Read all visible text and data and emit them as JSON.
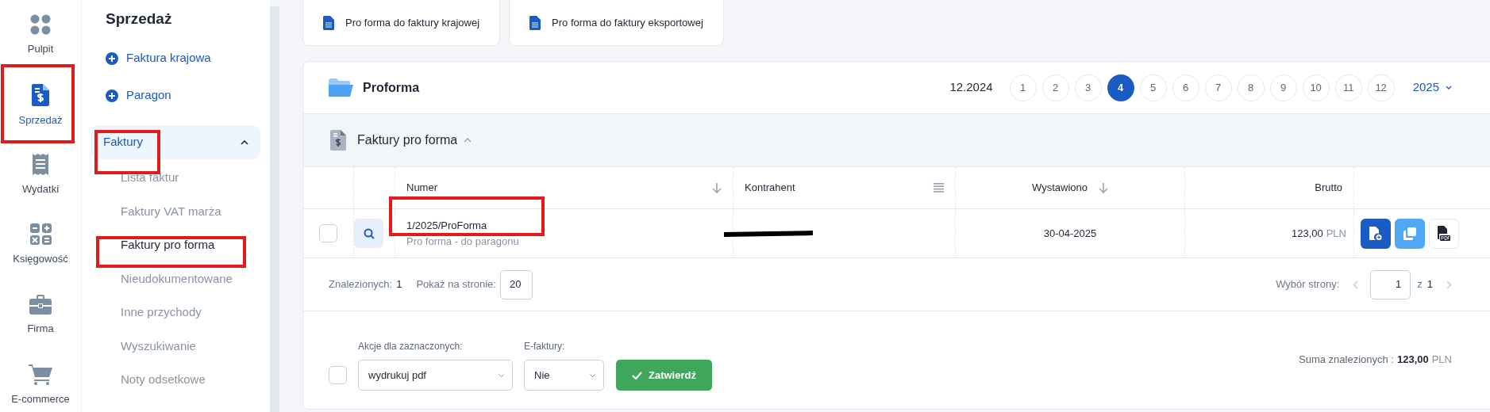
{
  "rail": [
    {
      "label": "Pulpit",
      "selected": false
    },
    {
      "label": "Sprzedaż",
      "selected": true
    },
    {
      "label": "Wydatki",
      "selected": false
    },
    {
      "label": "Księgowość",
      "selected": false
    },
    {
      "label": "Firma",
      "selected": false
    },
    {
      "label": "E-commerce",
      "selected": false
    }
  ],
  "sidebar": {
    "title": "Sprzedaż",
    "actions": [
      {
        "label": "Faktura krajowa"
      },
      {
        "label": "Paragon"
      }
    ],
    "group": {
      "label": "Faktury",
      "expanded": true,
      "children": [
        {
          "label": "Lista faktur",
          "selected": false
        },
        {
          "label": "Faktury VAT marża",
          "selected": false
        },
        {
          "label": "Faktury pro forma",
          "selected": true
        },
        {
          "label": "Nieudokumentowane",
          "selected": false
        },
        {
          "label": "Inne przychody",
          "selected": false
        },
        {
          "label": "Wyszukiwanie",
          "selected": false
        },
        {
          "label": "Noty odsetkowe",
          "selected": false
        }
      ]
    }
  },
  "top_buttons": [
    {
      "label": "Pro forma do faktury krajowej"
    },
    {
      "label": "Pro forma do faktury eksportowej"
    }
  ],
  "panel": {
    "title": "Proforma",
    "prev_period": "12.2024",
    "months": [
      {
        "label": "1",
        "selected": false
      },
      {
        "label": "2",
        "selected": false
      },
      {
        "label": "3",
        "selected": false
      },
      {
        "label": "4",
        "selected": true
      },
      {
        "label": "5",
        "selected": false
      },
      {
        "label": "6",
        "selected": false
      },
      {
        "label": "7",
        "selected": false
      },
      {
        "label": "8",
        "selected": false
      },
      {
        "label": "9",
        "selected": false
      },
      {
        "label": "10",
        "selected": false
      },
      {
        "label": "11",
        "selected": false
      },
      {
        "label": "12",
        "selected": false
      }
    ],
    "year": "2025"
  },
  "section": {
    "title": "Faktury pro forma",
    "expanded": true
  },
  "table": {
    "columns": [
      {
        "label": "Numer",
        "kind": "sort"
      },
      {
        "label": "Kontrahent",
        "kind": "menu"
      },
      {
        "label": "Wystawiono",
        "kind": "sort"
      },
      {
        "label": "Brutto",
        "kind": "plain"
      }
    ],
    "rows": [
      {
        "checked": false,
        "number": "1/2025/ProForma",
        "subtitle": "Pro forma - do paragonu",
        "contractor_redacted": true,
        "issued": "30-04-2025",
        "amount": "123,00",
        "currency": "PLN"
      }
    ]
  },
  "footer": {
    "found_label": "Znalezionych:",
    "found": "1",
    "per_page_label": "Pokaż na stronie:",
    "per_page": "20",
    "page_label": "Wybór strony:",
    "page": "1",
    "of": "z",
    "pages": "1"
  },
  "bulk": {
    "checked": false,
    "action_label": "Akcje dla zaznaczonych:",
    "action": "wydrukuj pdf",
    "efaktury_label": "E-faktury:",
    "efaktury": "Nie",
    "submit": "Zatwierdź",
    "sum_label": "Suma znalezionych :",
    "sum": "123,00",
    "sum_currency": "PLN"
  }
}
